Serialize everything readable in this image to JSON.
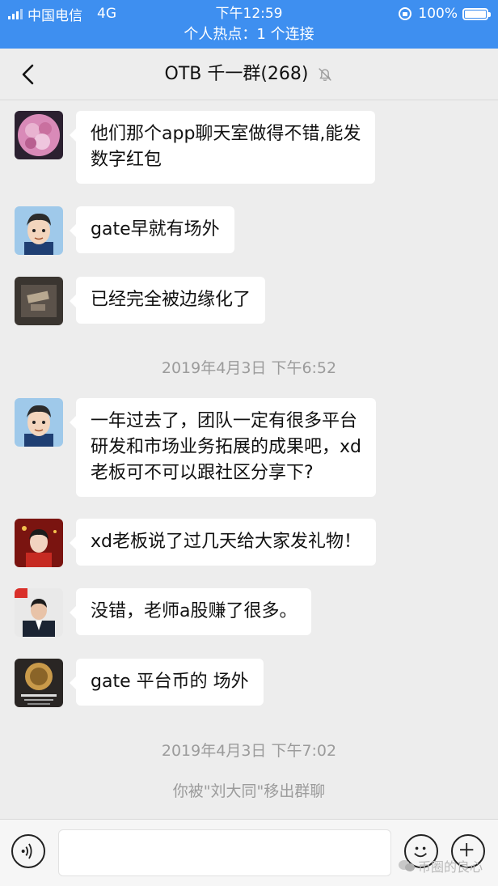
{
  "status_bar": {
    "carrier": "中国电信",
    "network": "4G",
    "time": "下午12:59",
    "battery": "100%",
    "hotspot": "个人热点：1 个连接"
  },
  "header": {
    "title": "OTB 千一群(268)",
    "icons": [
      "back-chevron-icon",
      "mute-bell-icon"
    ]
  },
  "messages": [
    {
      "avatar": "pink-flower-avatar",
      "lines": [
        "他们那个app聊天室做得不错,能发",
        "数字红包"
      ]
    },
    {
      "avatar": "cartoon-man-avatar",
      "lines": [
        "gate早就有场外"
      ]
    },
    {
      "avatar": "dark-photo-avatar",
      "lines": [
        "已经完全被边缘化了"
      ]
    },
    {
      "avatar": "cartoon-man-avatar",
      "lines": [
        "一年过去了，团队一定有很多平台",
        "研发和市场业务拓展的成果吧，xd",
        "老板可不可以跟社区分享下?"
      ]
    },
    {
      "avatar": "red-portrait-avatar",
      "lines": [
        "xd老板说了过几天给大家发礼物！"
      ]
    },
    {
      "avatar": "suit-man-avatar",
      "lines": [
        "没错，老师a股赚了很多。"
      ]
    },
    {
      "avatar": "coin-poster-avatar",
      "lines": [
        "gate 平台币的 场外"
      ]
    }
  ],
  "system": {
    "time_1": "2019年4月3日 下午6:52",
    "time_2": "2019年4月3日 下午7:02",
    "removed_notice": "你被\"刘大同\"移出群聊"
  },
  "input_bar": {
    "icons": [
      "voice-icon",
      "emoji-icon",
      "plus-icon"
    ],
    "value": ""
  },
  "watermark": "币圈的良心",
  "colors": {
    "status_bar": "#3e8ff0",
    "background": "#ededed",
    "bubble": "#ffffff",
    "system_text": "#9b9b9b"
  }
}
